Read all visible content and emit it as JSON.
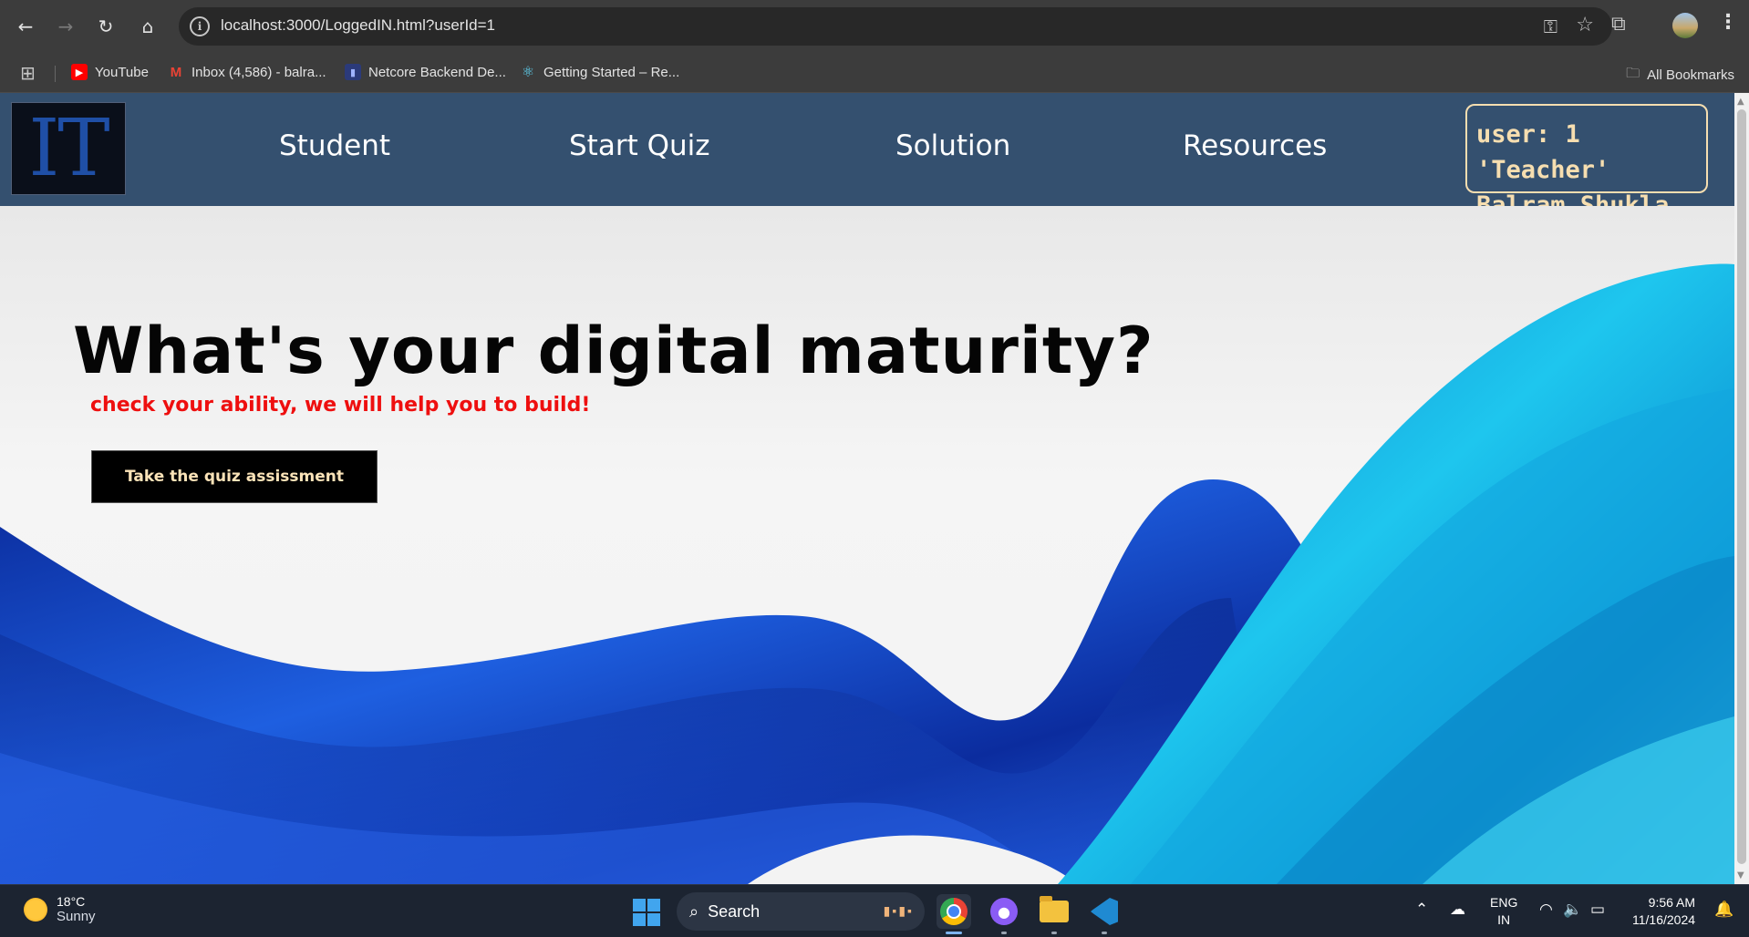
{
  "browser": {
    "url": "localhost:3000/LoggedIN.html?userId=1",
    "bookmarks": [
      {
        "label": "YouTube"
      },
      {
        "label": "Inbox (4,586) - balra..."
      },
      {
        "label": "Netcore Backend De..."
      },
      {
        "label": "Getting Started – Re..."
      }
    ],
    "all_bookmarks": "All Bookmarks"
  },
  "site": {
    "logo_text": "IT",
    "nav": [
      {
        "label": "Student"
      },
      {
        "label": "Start Quiz"
      },
      {
        "label": "Solution"
      },
      {
        "label": "Resources"
      }
    ],
    "user": {
      "line1": "user: 1 'Teacher'",
      "line2": "Balram Shukla"
    }
  },
  "hero": {
    "headline": "What's your digital maturity?",
    "subline": "check your ability, we will help you to build!",
    "cta_label": "Take the quiz assissment"
  },
  "taskbar": {
    "weather_temp": "18°C",
    "weather_desc": "Sunny",
    "search_label": "Search",
    "lang_line1": "ENG",
    "lang_line2": "IN",
    "time": "9:56 AM",
    "date": "11/16/2024"
  },
  "colors": {
    "site_nav_bg": "#34506f",
    "user_box_color": "#f6deb0",
    "subline_color": "#ee0f0f",
    "cta_bg": "#000000"
  }
}
